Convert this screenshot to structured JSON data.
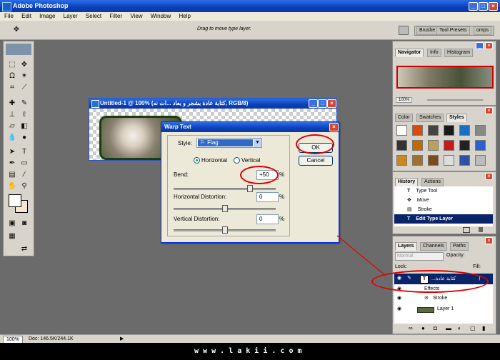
{
  "app": {
    "title": "Adobe Photoshop",
    "menu": [
      "File",
      "Edit",
      "Image",
      "Layer",
      "Select",
      "Filter",
      "View",
      "Window",
      "Help"
    ],
    "hint": "Drag to move type layer.",
    "well_tabs": [
      "Brushe",
      "Tool Presets",
      "omps"
    ]
  },
  "document": {
    "title": "Untitled-1 @ 100% (کتابة عادة بشجر و بعاد ...ات نه, RGB/8)",
    "zoom": "100%",
    "doc_info": "Doc: 146.5K/244.1K"
  },
  "dialog": {
    "title": "Warp Text",
    "style_label": "Style:",
    "style_value": "Flag",
    "horizontal_label": "Horizontal",
    "vertical_label": "Vertical",
    "bend_label": "Bend:",
    "bend_value": "+50",
    "hdist_label": "Horizontal Distortion:",
    "hdist_value": "0",
    "vdist_label": "Vertical Distortion:",
    "vdist_value": "0",
    "pct": "%",
    "ok": "OK",
    "cancel": "Cancel",
    "bend_level": 0.75,
    "hdist_level": 0.5,
    "vdist_level": 0.5
  },
  "navigator": {
    "tabs": [
      "Navigator",
      "Info",
      "Histogram"
    ],
    "zoom": "100%"
  },
  "styles": {
    "tabs": [
      "Color",
      "Swatches",
      "Styles"
    ]
  },
  "history": {
    "tabs": [
      "History",
      "Actions"
    ],
    "items": [
      "Type Tool",
      "Move",
      "Stroke",
      "Edit Type Layer"
    ]
  },
  "layers": {
    "tabs": [
      "Layers",
      "Channels",
      "Paths"
    ],
    "blend_mode": "Normal",
    "opacity_label": "Opacity:",
    "lock_label": "Lock:",
    "fill_label": "Fill:",
    "type_layer_name": "...كتابة عادة",
    "effects": "Effects",
    "stroke": "Stroke",
    "layer1": "Layer 1"
  },
  "footer": {
    "site": "w w w . l a k i i . c o m"
  },
  "colors": {
    "xp_blue": "#0a3fb8",
    "annotation_red": "#e00000"
  }
}
